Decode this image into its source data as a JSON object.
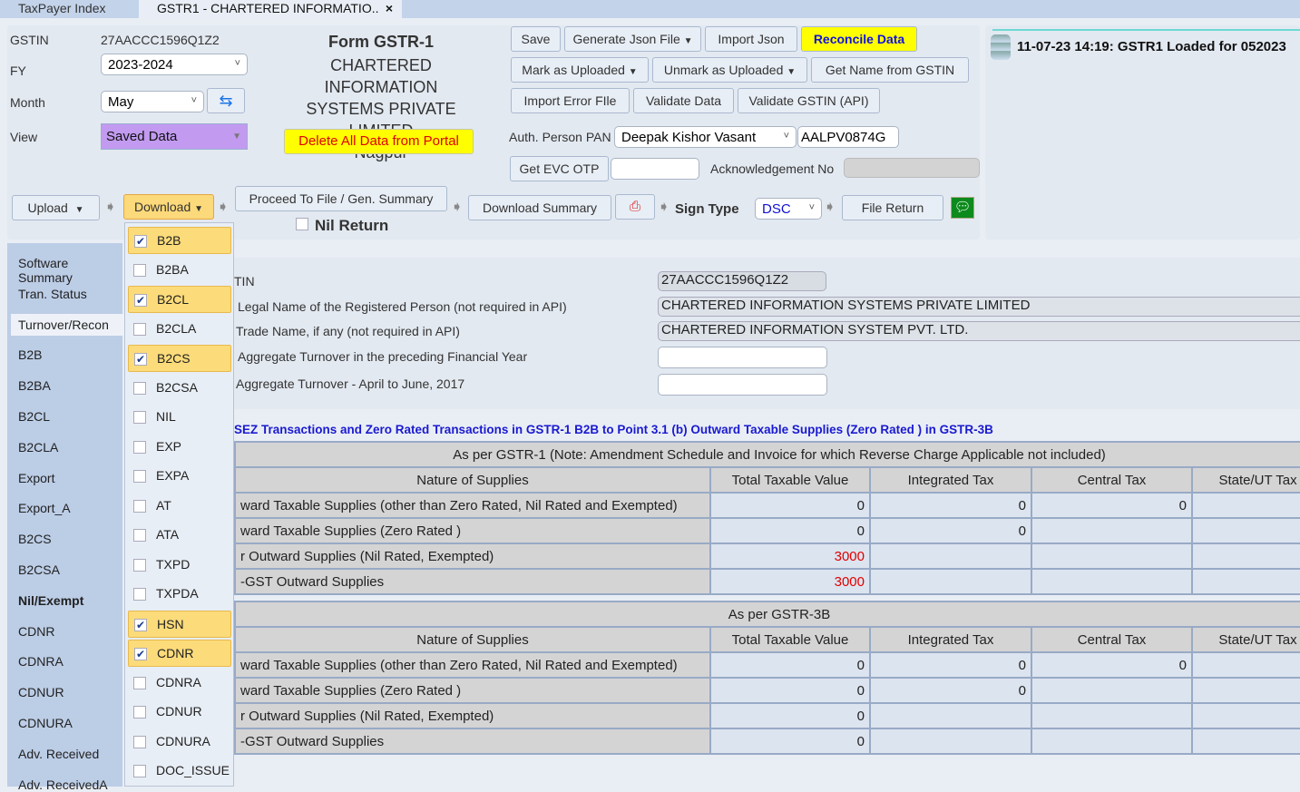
{
  "tabs": [
    {
      "label": "TaxPayer Index"
    },
    {
      "label": "GSTR1 - CHARTERED INFORMATIO..",
      "close": "×"
    }
  ],
  "header": {
    "gstin_label": "GSTIN",
    "gstin": "27AACCC1596Q1Z2",
    "fy_label": "FY",
    "fy": "2023-2024",
    "month_label": "Month",
    "month": "May",
    "view_label": "View",
    "view": "Saved Data",
    "view_color": "#c29af0",
    "form_title": "Form GSTR-1",
    "company_line1": "CHARTERED INFORMATION",
    "company_line2": "SYSTEMS PRIVATE LIMITED",
    "city": "Nagpur",
    "delete_button": "Delete All Data from Portal"
  },
  "toolbar": {
    "save": "Save",
    "generate_json": "Generate Json File",
    "import_json": "Import Json",
    "reconcile": "Reconcile Data",
    "mark_uploaded": "Mark as Uploaded",
    "unmark_uploaded": "Unmark as Uploaded",
    "get_name": "Get Name from GSTIN",
    "import_error": "Import Error FIle",
    "validate_data": "Validate Data",
    "validate_gstin": "Validate GSTIN (API)",
    "auth_label": "Auth. Person PAN",
    "auth_person": "Deepak Kishor Vasant",
    "auth_pan": "AALPV0874G",
    "get_otp": "Get EVC OTP",
    "otp_value": "",
    "ack_label": "Acknowledgement No",
    "ack_value": ""
  },
  "workflow": {
    "upload": "Upload",
    "download": "Download",
    "proceed": "Proceed To File / Gen. Summary",
    "nil_return": "Nil Return",
    "download_summary": "Download Summary",
    "sign_type_label": "Sign Type",
    "sign_type": "DSC",
    "file_return": "File Return"
  },
  "log": {
    "message": "11-07-23 14:19: GSTR1 Loaded for 052023"
  },
  "sidebar": [
    "Software Summary",
    "Tran. Status",
    "Turnover/Recon",
    "B2B",
    "B2BA",
    "B2CL",
    "B2CLA",
    "Export",
    "Export_A",
    "B2CS",
    "B2CSA",
    "Nil/Exempt",
    "CDNR",
    "CDNRA",
    "CDNUR",
    "CDNURA",
    "Adv. Received",
    "Adv. ReceivedA"
  ],
  "download_menu": [
    {
      "label": "B2B",
      "checked": true
    },
    {
      "label": "B2BA",
      "checked": false
    },
    {
      "label": "B2CL",
      "checked": true
    },
    {
      "label": "B2CLA",
      "checked": false
    },
    {
      "label": "B2CS",
      "checked": true
    },
    {
      "label": "B2CSA",
      "checked": false
    },
    {
      "label": "NIL",
      "checked": false
    },
    {
      "label": "EXP",
      "checked": false
    },
    {
      "label": "EXPA",
      "checked": false
    },
    {
      "label": "AT",
      "checked": false
    },
    {
      "label": "ATA",
      "checked": false
    },
    {
      "label": "TXPD",
      "checked": false
    },
    {
      "label": "TXPDA",
      "checked": false
    },
    {
      "label": "HSN",
      "checked": true
    },
    {
      "label": "CDNR",
      "checked": true
    },
    {
      "label": "CDNRA",
      "checked": false
    },
    {
      "label": "CDNUR",
      "checked": false
    },
    {
      "label": "CDNURA",
      "checked": false
    },
    {
      "label": "DOC_ISSUE",
      "checked": false
    }
  ],
  "turnover": {
    "gstin_label": "TIN",
    "gstin": "27AACCC1596Q1Z2",
    "legal_label": "Legal Name of the Registered Person (not required in API)",
    "legal": "CHARTERED INFORMATION SYSTEMS PRIVATE LIMITED",
    "trade_label": "Trade Name, if any (not required in API)",
    "trade": "CHARTERED INFORMATION SYSTEM PVT. LTD.",
    "agg_prev_label": "Aggregate Turnover in the preceding Financial Year",
    "agg_prev": "",
    "agg_q1_label": "Aggregate Turnover - April to June, 2017",
    "agg_q1": "",
    "recon_title": "SEZ Transactions and Zero Rated Transactions in GSTR-1 B2B to Point 3.1 (b) Outward Taxable  Supplies  (Zero Rated ) in GSTR-3B"
  },
  "columns": [
    "Nature of Supplies",
    "Total Taxable Value",
    "Integrated Tax",
    "Central Tax",
    "State/UT Tax"
  ],
  "table1": {
    "title": "As per GSTR-1 (Note: Amendment Schedule and Invoice for which Reverse Charge Applicable not included)",
    "rows": [
      [
        "ward Taxable  Supplies  (other than Zero Rated, Nil Rated and Exempted)",
        "0",
        "0",
        "0",
        ""
      ],
      [
        "ward Taxable  Supplies  (Zero Rated )",
        "0",
        "0",
        "",
        ""
      ],
      [
        "r Outward Supplies (Nil Rated, Exempted)",
        "3000",
        "",
        "",
        ""
      ],
      [
        "-GST Outward Supplies",
        "3000",
        "",
        "",
        ""
      ]
    ]
  },
  "table2": {
    "title": "As per GSTR-3B",
    "rows": [
      [
        "ward Taxable  Supplies  (other than Zero Rated, Nil Rated and Exempted)",
        "0",
        "0",
        "0",
        ""
      ],
      [
        "ward Taxable  Supplies  (Zero Rated )",
        "0",
        "0",
        "",
        ""
      ],
      [
        "r Outward Supplies (Nil Rated, Exempted)",
        "0",
        "",
        "",
        ""
      ],
      [
        "-GST Outward Supplies",
        "0",
        "",
        "",
        ""
      ]
    ]
  }
}
